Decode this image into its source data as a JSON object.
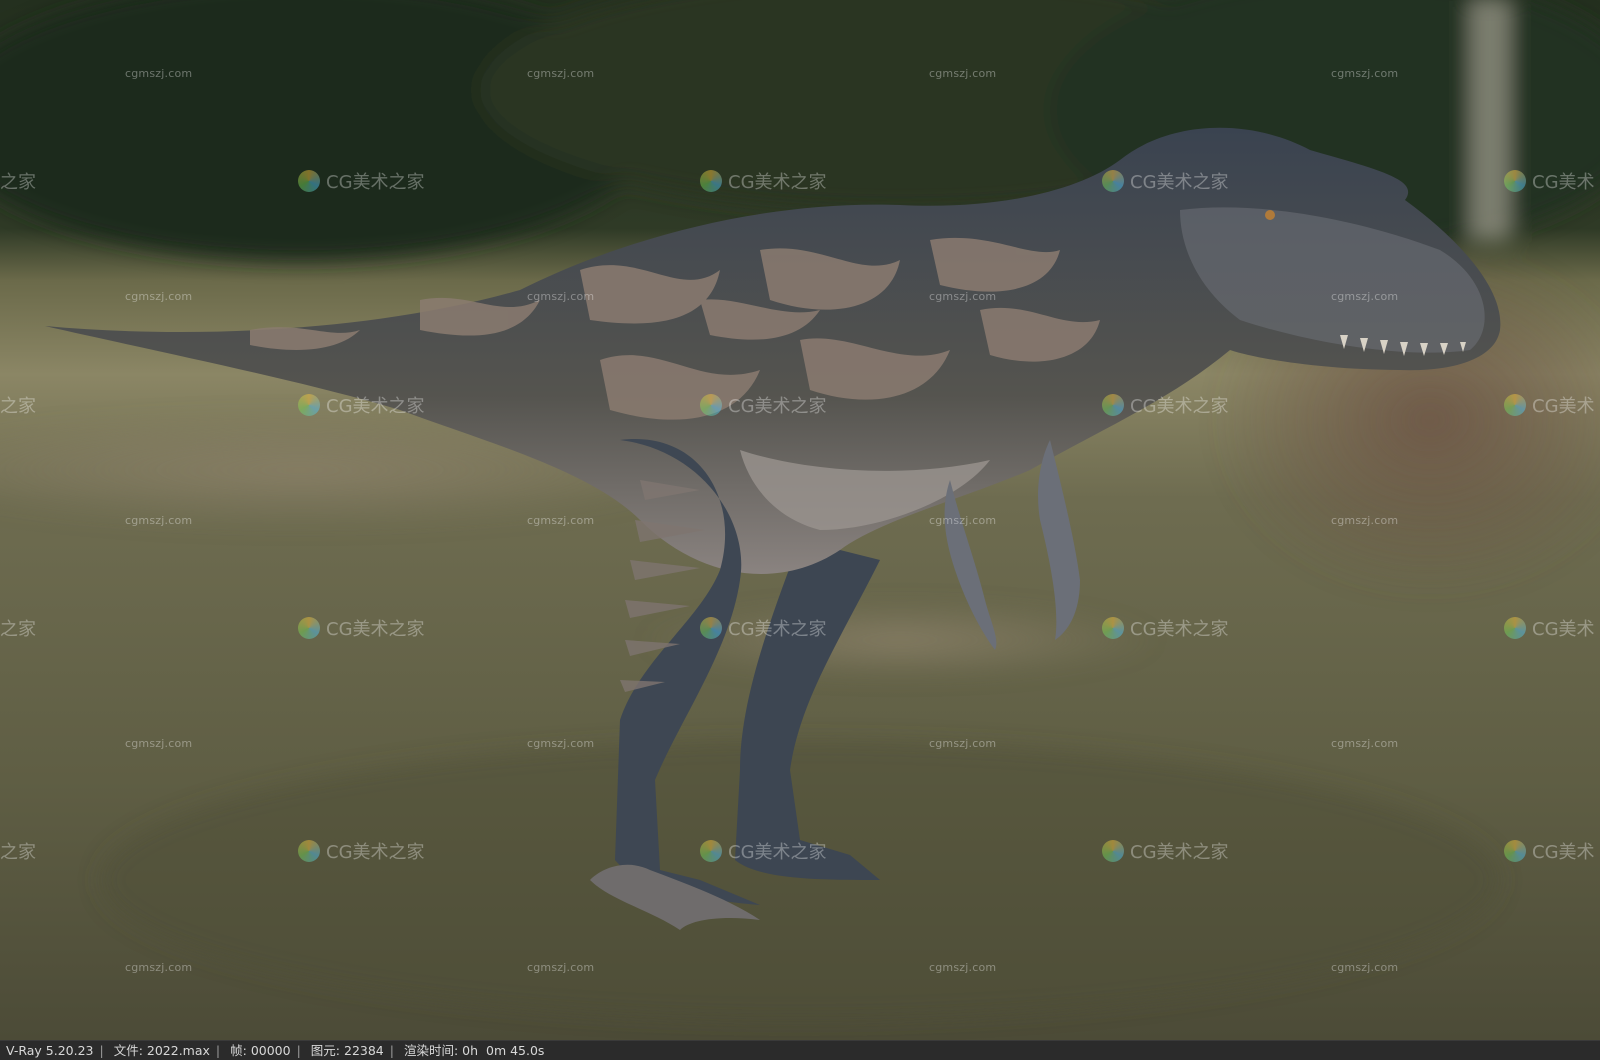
{
  "watermark": {
    "url_text": "cgmszj.com",
    "brand_text": "CG美术之家",
    "brand_partial": "之家",
    "brand_partial_right": "CG美术"
  },
  "status_bar": {
    "renderer": "V-Ray 5.20.23",
    "file_label": "文件:",
    "file_value": "2022.max",
    "frame_label": "帧:",
    "frame_value": "00000",
    "primitives_label": "图元:",
    "primitives_value": "22384",
    "render_time_label": "渲染时间:",
    "render_time_value": "0h  0m 45.0s"
  },
  "colors": {
    "status_bg": "#2b2b2b",
    "status_text": "#d8d8d8",
    "dino_dark": "#2b3440",
    "dino_light": "#8f7f72"
  }
}
